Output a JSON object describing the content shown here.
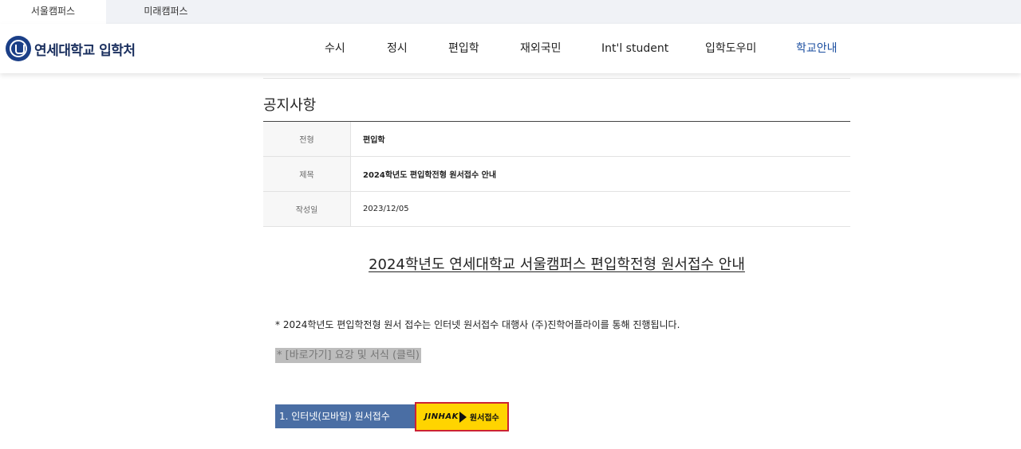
{
  "campus_tabs": [
    {
      "label": "서울캠퍼스",
      "active": true
    },
    {
      "label": "미래캠퍼스",
      "active": false
    }
  ],
  "header": {
    "logo_text": "연세대학교 입학처",
    "nav": [
      "수시",
      "정시",
      "편입학",
      "재외국민",
      "Int'l student",
      "입학도우미",
      "학교안내"
    ]
  },
  "notice": {
    "section_title": "공지사항",
    "rows": [
      {
        "label": "전형",
        "value": "편입학"
      },
      {
        "label": "제목",
        "value": "2024학년도 편입학전형 원서접수 안내"
      },
      {
        "label": "작성일",
        "value": "2023/12/05"
      }
    ]
  },
  "article": {
    "heading": "2024학년도 연세대학교 서울캠퍼스 편입학전형 원서접수 안내",
    "paragraph": "* 2024학년도 편입학전형 원서 접수는 인터넷 원서접수 대행사 (주)진학어플라이를 통해 진행됩니다.",
    "link_text": "* [바로가기] 요강 및 서식 (클릭)",
    "apply_bar_label": "1. 인터넷(모바일) 원서접수",
    "apply_button": {
      "logo_text": "JINHAK",
      "label": "원서접수"
    }
  },
  "colors": {
    "nav_highlight": "#1c4fa0",
    "apply_bar": "#4a6ea4",
    "apply_button_bg": "#ffd400",
    "apply_button_border": "#cc2233"
  }
}
